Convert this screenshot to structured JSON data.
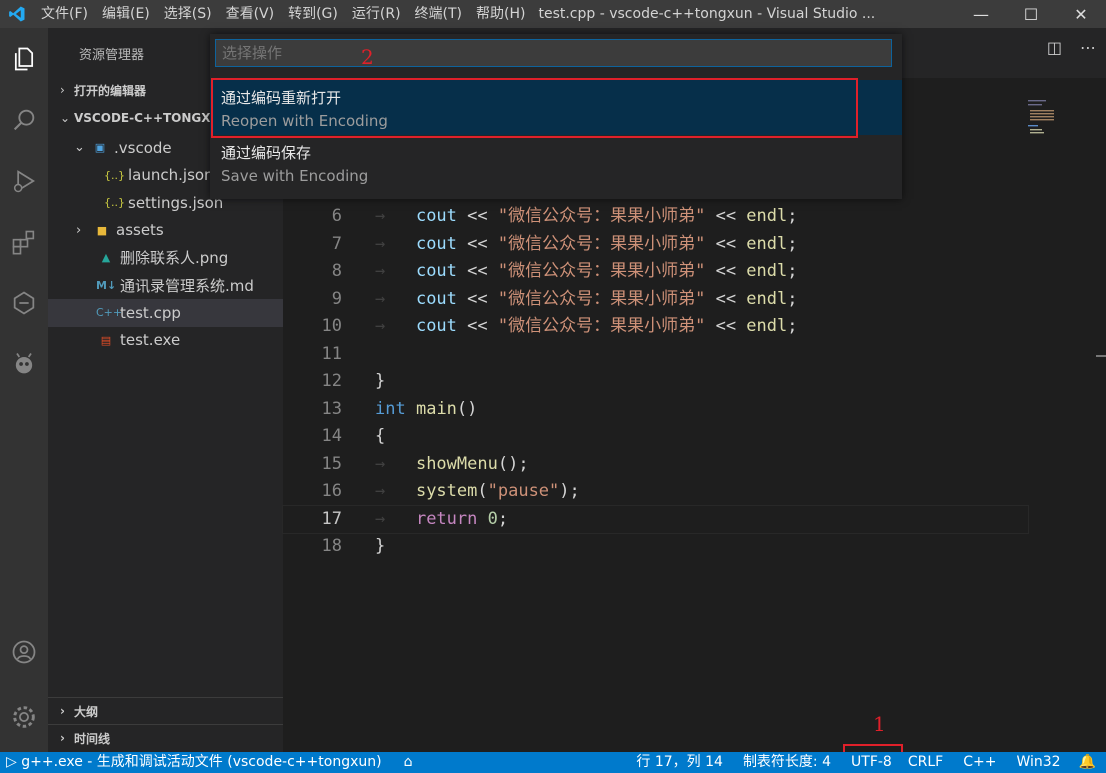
{
  "titlebar": {
    "menu": [
      "文件(F)",
      "编辑(E)",
      "选择(S)",
      "查看(V)",
      "转到(G)",
      "运行(R)",
      "终端(T)",
      "帮助(H)"
    ],
    "title": "test.cpp - vscode-c++tongxun - Visual Studio ..."
  },
  "sidebar": {
    "header": "资源管理器",
    "open_editors": "打开的编辑器",
    "workspace": "VSCODE-C++TONGX",
    "tree": {
      "vscode_folder": ".vscode",
      "launch": "launch.json",
      "settings": "settings.json",
      "assets": "assets",
      "png": "删除联系人.png",
      "md": "通讯录管理系统.md",
      "cpp": "test.cpp",
      "exe": "test.exe"
    },
    "outline": "大纲",
    "timeline": "时间线"
  },
  "quickpick": {
    "placeholder": "选择操作",
    "items": [
      {
        "label": "通过编码重新打开",
        "description": "Reopen with Encoding"
      },
      {
        "label": "通过编码保存",
        "description": "Save with Encoding"
      }
    ]
  },
  "annotations": {
    "one": "1",
    "two": "2",
    "color": "#e0202a"
  },
  "code": {
    "lines": [
      {
        "n": "6",
        "parts": [
          [
            "cout",
            "var"
          ],
          [
            " << ",
            ""
          ],
          [
            "\"微信公众号：果果小师弟\"",
            "str"
          ],
          [
            " << ",
            ""
          ],
          [
            "endl",
            "fn"
          ],
          [
            ";",
            ""
          ]
        ],
        "indent": true
      },
      {
        "n": "7",
        "parts": [
          [
            "cout",
            "var"
          ],
          [
            " << ",
            ""
          ],
          [
            "\"微信公众号：果果小师弟\"",
            "str"
          ],
          [
            " << ",
            ""
          ],
          [
            "endl",
            "fn"
          ],
          [
            ";",
            ""
          ]
        ],
        "indent": true
      },
      {
        "n": "8",
        "parts": [
          [
            "cout",
            "var"
          ],
          [
            " << ",
            ""
          ],
          [
            "\"微信公众号：果果小师弟\"",
            "str"
          ],
          [
            " << ",
            ""
          ],
          [
            "endl",
            "fn"
          ],
          [
            ";",
            ""
          ]
        ],
        "indent": true
      },
      {
        "n": "9",
        "parts": [
          [
            "cout",
            "var"
          ],
          [
            " << ",
            ""
          ],
          [
            "\"微信公众号：果果小师弟\"",
            "str"
          ],
          [
            " << ",
            ""
          ],
          [
            "endl",
            "fn"
          ],
          [
            ";",
            ""
          ]
        ],
        "indent": true
      },
      {
        "n": "10",
        "parts": [
          [
            "cout",
            "var"
          ],
          [
            " << ",
            ""
          ],
          [
            "\"微信公众号：果果小师弟\"",
            "str"
          ],
          [
            " << ",
            ""
          ],
          [
            "endl",
            "fn"
          ],
          [
            ";",
            ""
          ]
        ],
        "indent": true
      },
      {
        "n": "11",
        "parts": [],
        "indent": false
      },
      {
        "n": "12",
        "parts": [
          [
            "}",
            ""
          ]
        ],
        "indent": false
      },
      {
        "n": "13",
        "parts": [
          [
            "int",
            "kw"
          ],
          [
            " ",
            ""
          ],
          [
            "main",
            "fn"
          ],
          [
            "()",
            ""
          ]
        ],
        "indent": false
      },
      {
        "n": "14",
        "parts": [
          [
            "{",
            ""
          ]
        ],
        "indent": false
      },
      {
        "n": "15",
        "parts": [
          [
            "showMenu",
            "fn"
          ],
          [
            "();",
            ""
          ]
        ],
        "indent": true
      },
      {
        "n": "16",
        "parts": [
          [
            "system",
            "fn"
          ],
          [
            "(",
            ""
          ],
          [
            "\"pause\"",
            "str"
          ],
          [
            ");",
            ""
          ]
        ],
        "indent": true
      },
      {
        "n": "17",
        "parts": [
          [
            "return",
            "ctl"
          ],
          [
            " ",
            ""
          ],
          [
            "0",
            "num"
          ],
          [
            ";",
            ""
          ]
        ],
        "indent": true,
        "current": true
      },
      {
        "n": "18",
        "parts": [
          [
            "}",
            ""
          ]
        ],
        "indent": false
      }
    ]
  },
  "statusbar": {
    "run": "g++.exe - 生成和调试活动文件 (vscode-c++tongxun)",
    "position": "行 17，列 14",
    "tab_size": "制表符长度: 4",
    "encoding": "UTF-8",
    "eol": "CRLF",
    "language": "C++",
    "platform": "Win32"
  },
  "colors": {
    "accent": "#007acc",
    "titlebar": "#3c3c3c",
    "editor_bg": "#1e1e1e"
  }
}
